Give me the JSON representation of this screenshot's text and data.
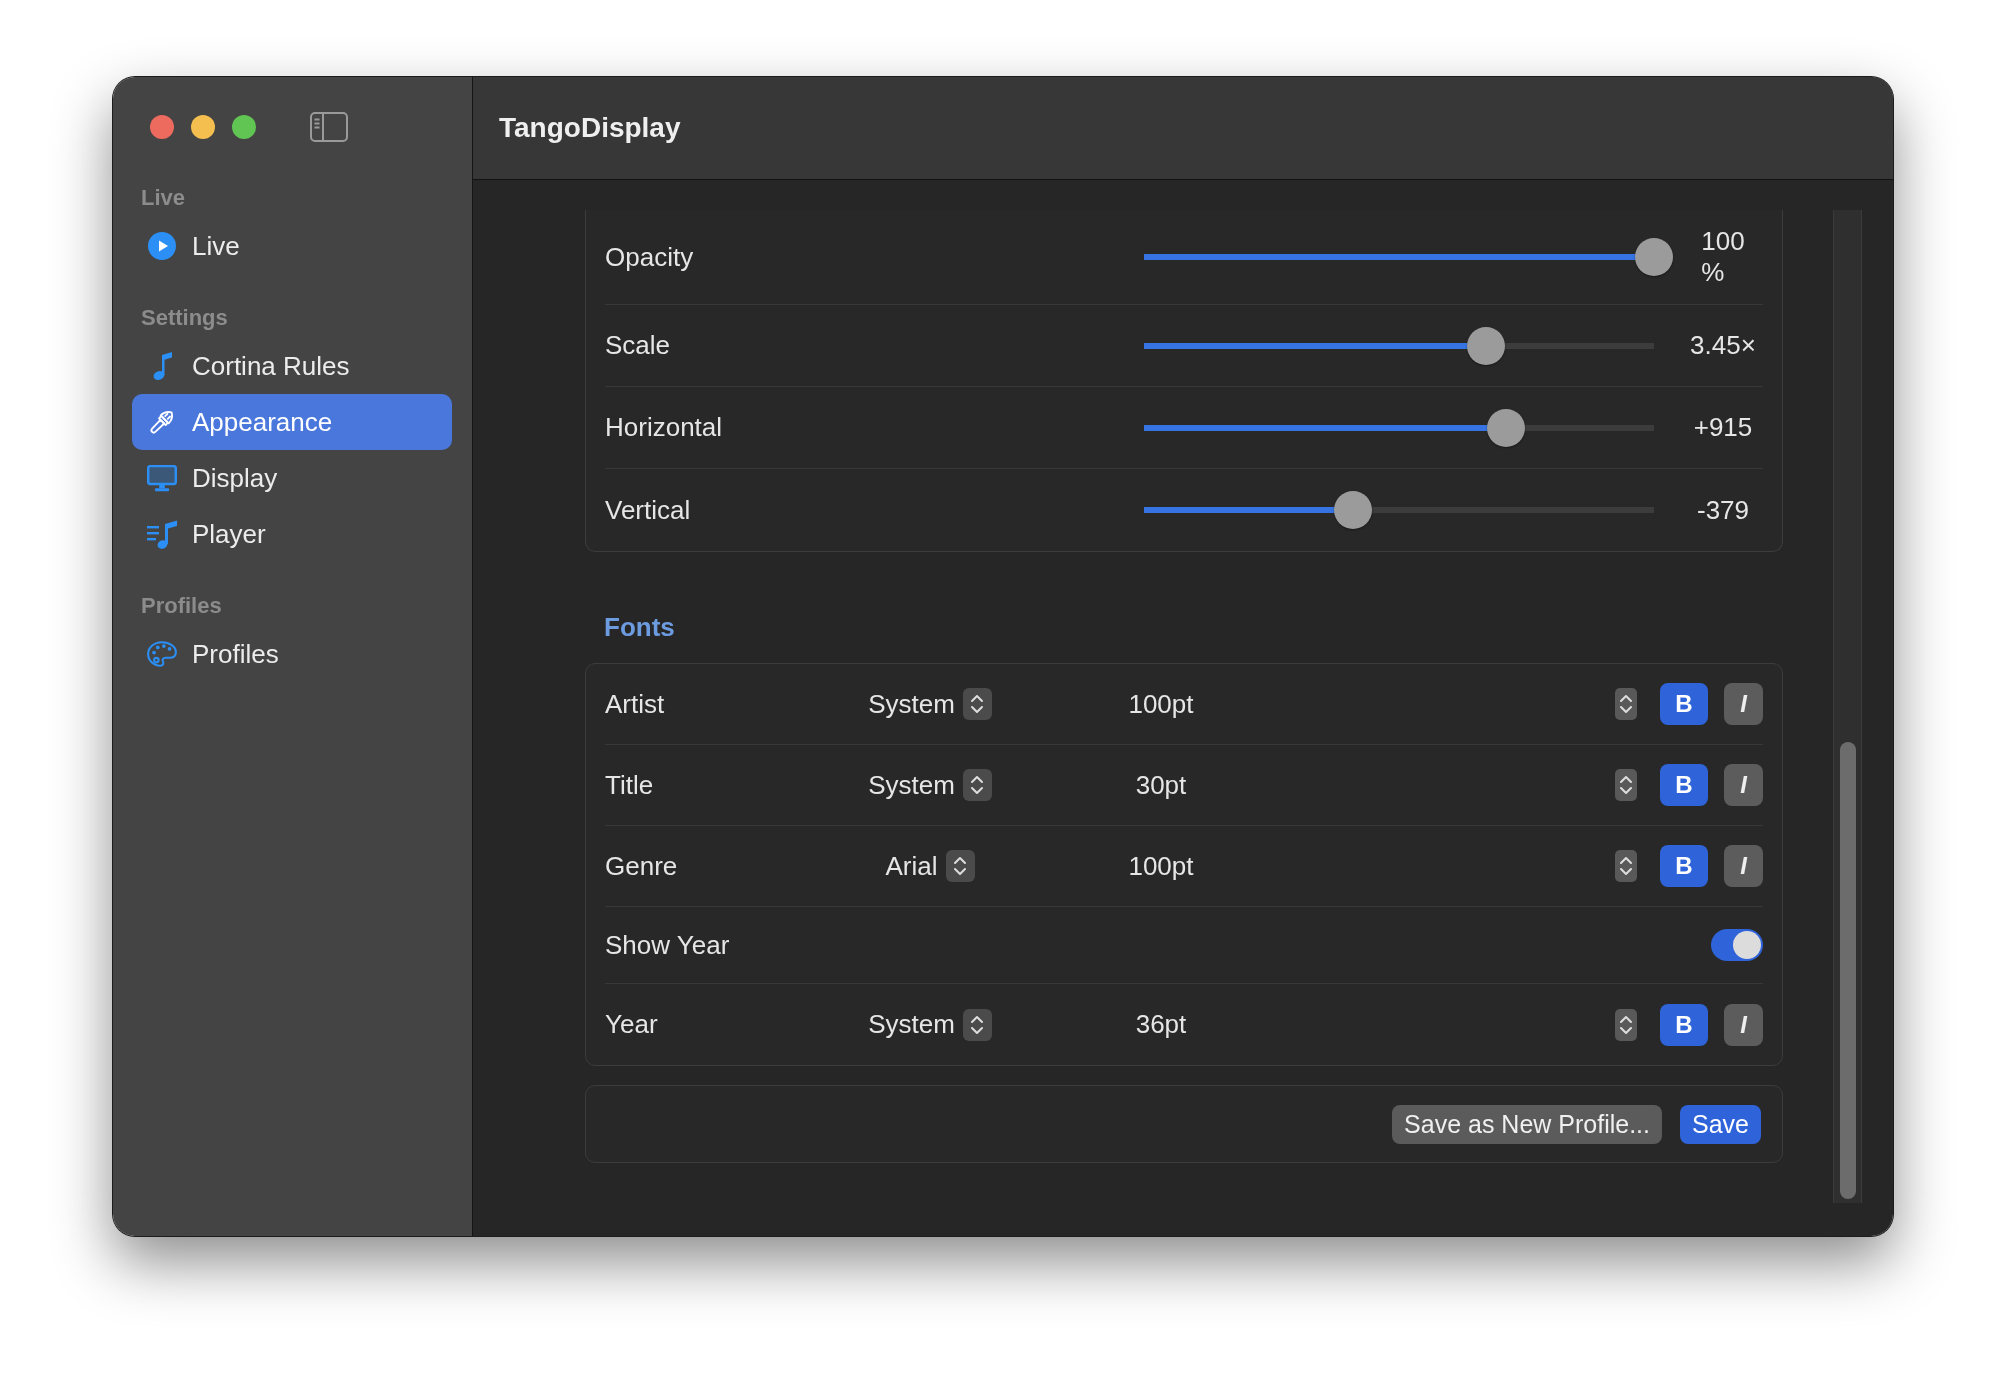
{
  "window": {
    "title": "TangoDisplay"
  },
  "sidebar": {
    "sections": [
      {
        "header": "Live",
        "items": [
          {
            "label": "Live",
            "selected": false
          }
        ]
      },
      {
        "header": "Settings",
        "items": [
          {
            "label": "Cortina Rules",
            "selected": false
          },
          {
            "label": "Appearance",
            "selected": true
          },
          {
            "label": "Display",
            "selected": false
          },
          {
            "label": "Player",
            "selected": false
          }
        ]
      },
      {
        "header": "Profiles",
        "items": [
          {
            "label": "Profiles",
            "selected": false
          }
        ]
      }
    ]
  },
  "sliders": [
    {
      "label": "Opacity",
      "level": 1,
      "reading": "100 %"
    },
    {
      "label": "Scale",
      "level": 0.67,
      "reading": "3.45×"
    },
    {
      "label": "Horizontal",
      "level": 0.71,
      "reading": "+915"
    },
    {
      "label": "Vertical",
      "level": 0.41,
      "reading": "-379"
    }
  ],
  "fonts": {
    "heading": "Fonts",
    "rows": [
      {
        "kind": "font",
        "label": "Artist",
        "font": "System",
        "size": "100pt",
        "bold": {
          "label": "B",
          "on": true
        },
        "italic": {
          "label": "I",
          "on": false
        }
      },
      {
        "kind": "font",
        "label": "Title",
        "font": "System",
        "size": "30pt",
        "bold": {
          "label": "B",
          "on": true
        },
        "italic": {
          "label": "I",
          "on": false
        }
      },
      {
        "kind": "font",
        "label": "Genre",
        "font": "Arial",
        "size": "100pt",
        "bold": {
          "label": "B",
          "on": true
        },
        "italic": {
          "label": "I",
          "on": false
        }
      },
      {
        "kind": "toggle",
        "label": "Show Year",
        "on": true
      },
      {
        "kind": "font",
        "label": "Year",
        "font": "System",
        "size": "36pt",
        "bold": {
          "label": "B",
          "on": true
        },
        "italic": {
          "label": "I",
          "on": false
        }
      }
    ]
  },
  "actions": [
    {
      "label": "Save as New Profile...",
      "kind": "secondary"
    },
    {
      "label": "Save",
      "kind": "primary"
    }
  ]
}
